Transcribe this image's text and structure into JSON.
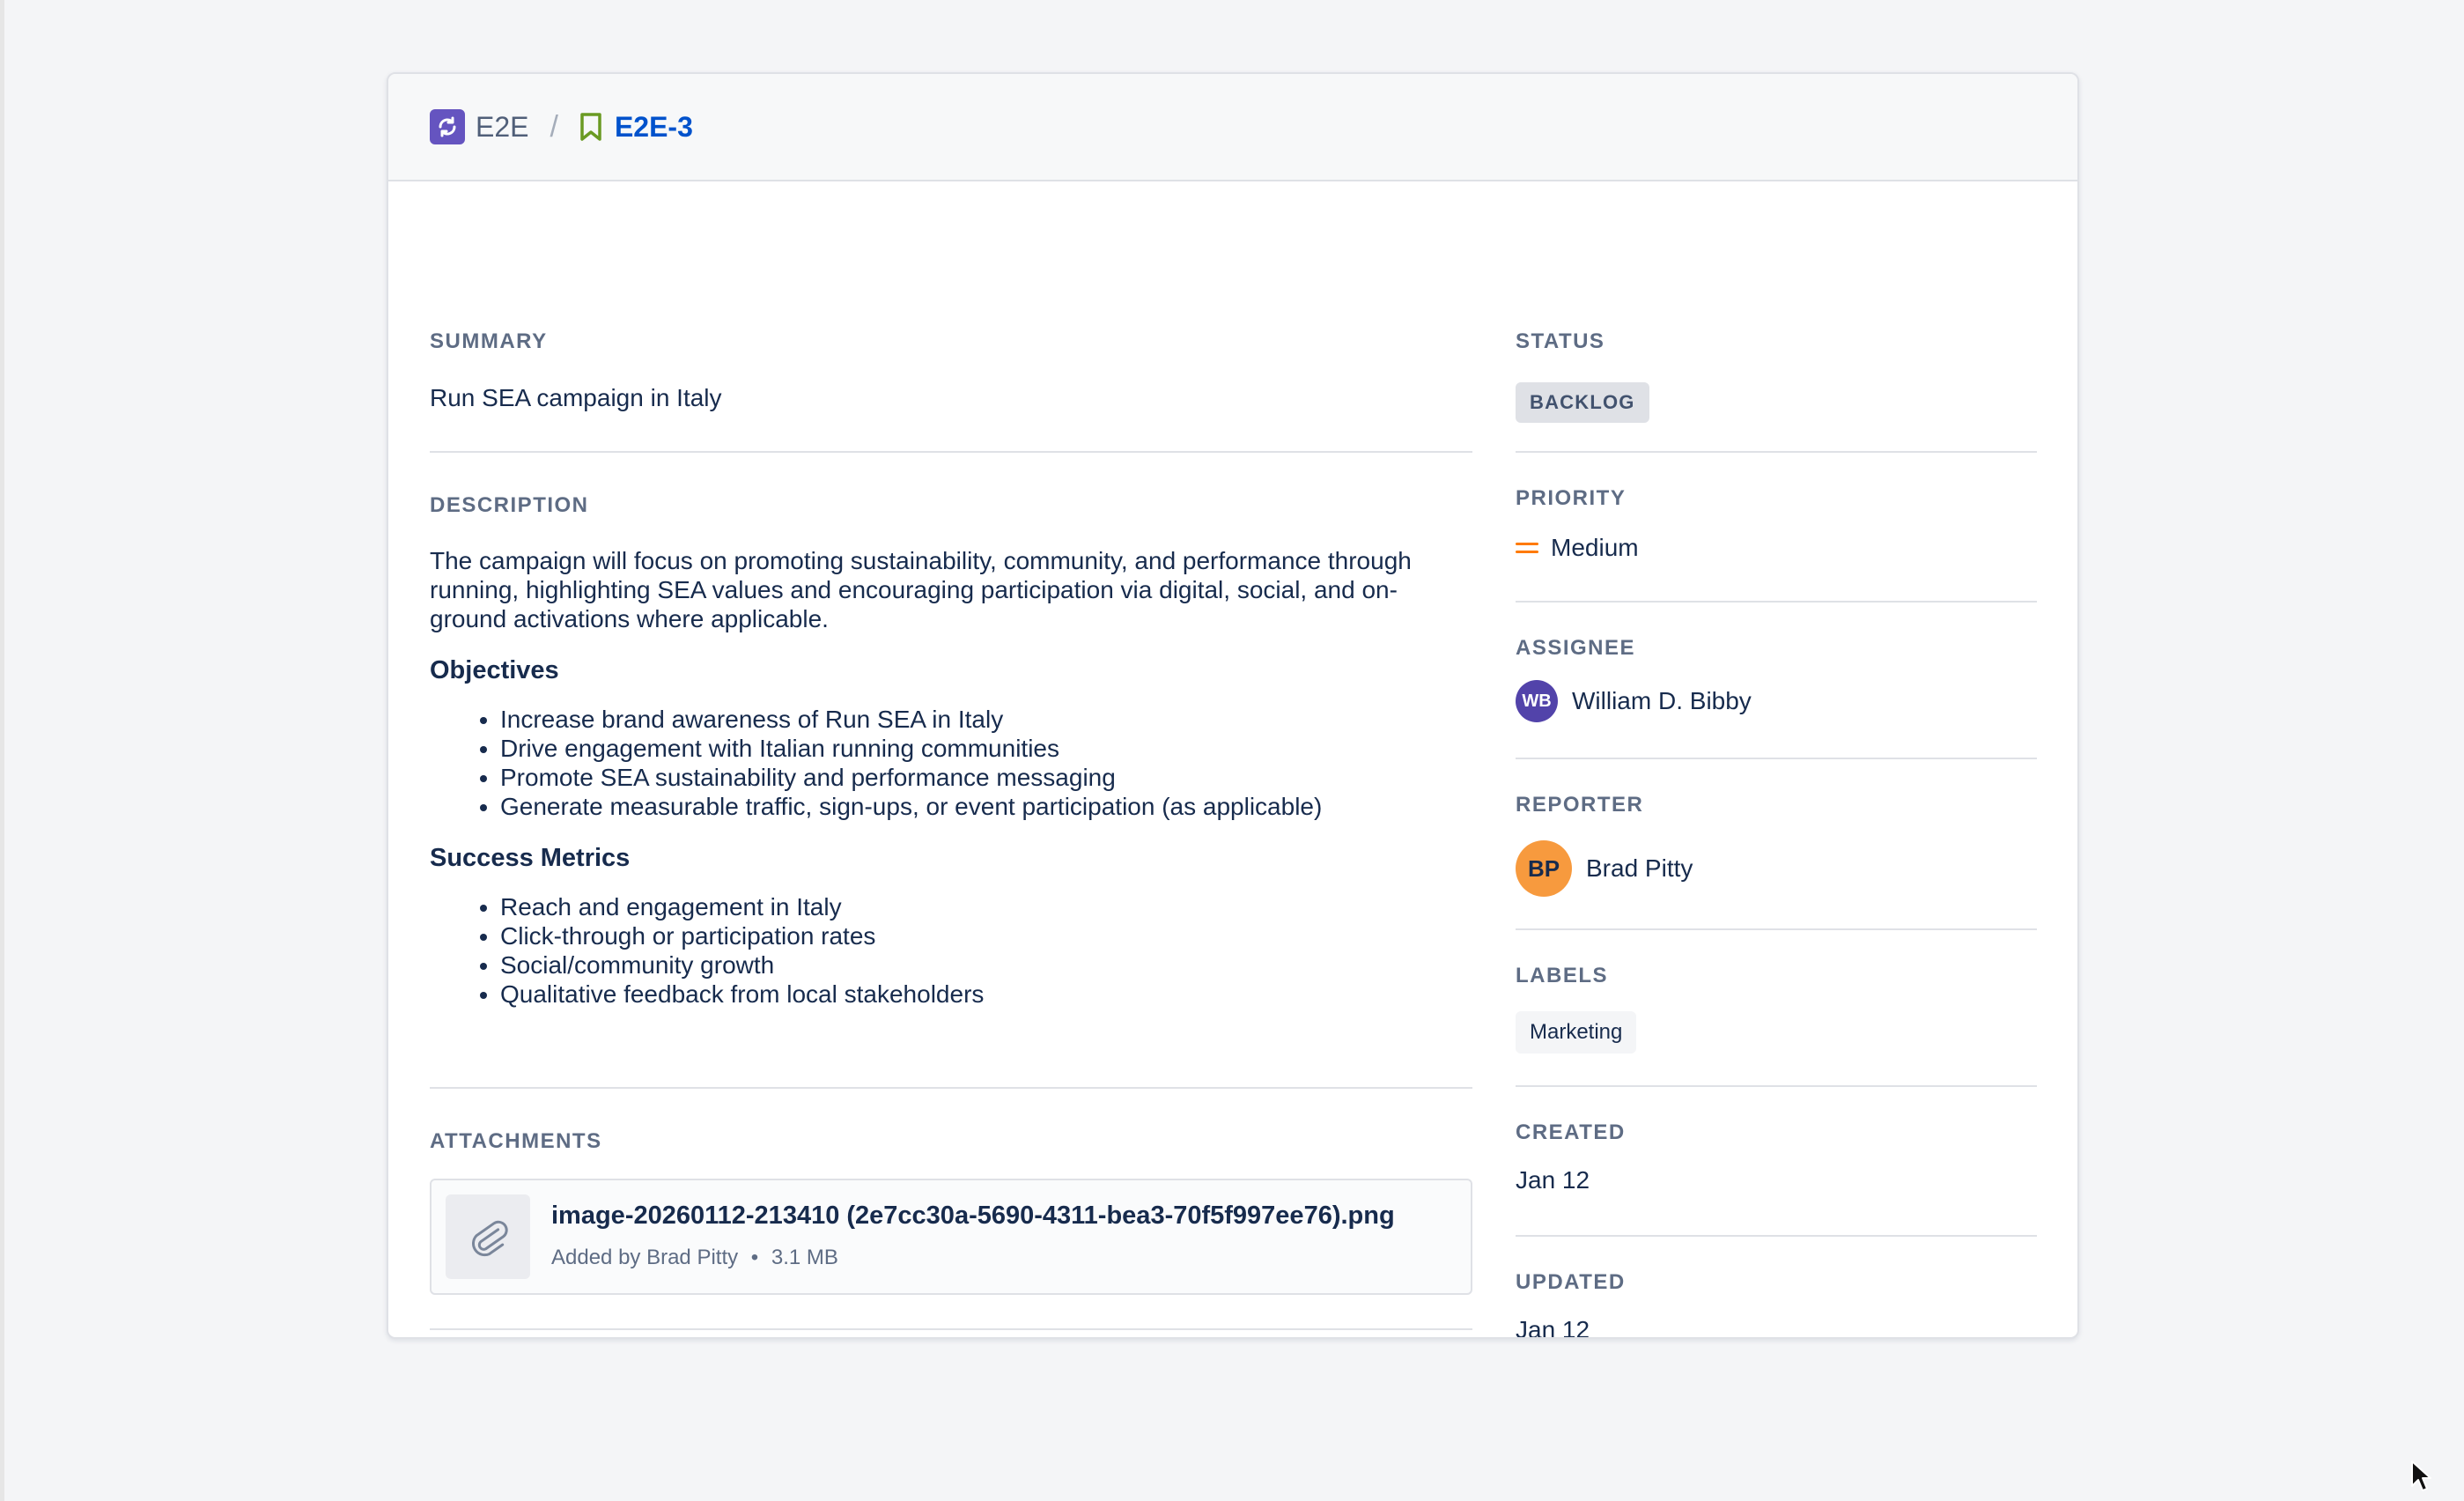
{
  "header": {
    "project_key": "E2E",
    "separator": "/",
    "issue_key": "E2E-3",
    "colors": {
      "project_icon": "#6554c0",
      "bookmark_icon": "#6a9a23",
      "issue_link": "#0052cc"
    }
  },
  "icons": {
    "project": "project-sync-icon",
    "issue_type": "bookmark-icon",
    "priority": "priority-medium-icon",
    "attachment": "paperclip-icon",
    "cursor": "mouse-cursor-icon"
  },
  "summary": {
    "label": "SUMMARY",
    "value": "Run SEA campaign in Italy"
  },
  "description": {
    "label": "DESCRIPTION",
    "intro": "The campaign will focus on promoting sustainability, community, and performance through running, highlighting SEA values and encouraging participation via digital, social, and on-ground activations where applicable.",
    "objectives_heading": "Objectives",
    "objectives": [
      "Increase brand awareness of Run SEA in Italy",
      "Drive engagement with Italian running communities",
      "Promote SEA sustainability and performance messaging",
      "Generate measurable traffic, sign-ups, or event participation (as applicable)"
    ],
    "metrics_heading": "Success Metrics",
    "metrics": [
      "Reach and engagement in Italy",
      "Click-through or participation rates",
      "Social/community growth",
      "Qualitative feedback from local stakeholders"
    ]
  },
  "attachments": {
    "label": "ATTACHMENTS",
    "items": [
      {
        "name": "image-20260112-213410 (2e7cc30a-5690-4311-bea3-70f5f997ee76).png",
        "added_by": "Added by Brad Pitty",
        "bullet": "•",
        "size": "3.1 MB"
      }
    ]
  },
  "sidebar": {
    "status": {
      "label": "STATUS",
      "value": "BACKLOG"
    },
    "priority": {
      "label": "PRIORITY",
      "value": "Medium",
      "color": "#ff7a00"
    },
    "assignee": {
      "label": "ASSIGNEE",
      "initials": "WB",
      "name": "William D. Bibby",
      "avatar_color": "#5243aa"
    },
    "reporter": {
      "label": "REPORTER",
      "initials": "BP",
      "name": "Brad Pitty",
      "avatar_color": "#f79a3e"
    },
    "labels": {
      "label": "LABELS",
      "items": [
        "Marketing"
      ]
    },
    "created": {
      "label": "CREATED",
      "value": "Jan 12"
    },
    "updated": {
      "label": "UPDATED",
      "value": "Jan 12"
    }
  }
}
